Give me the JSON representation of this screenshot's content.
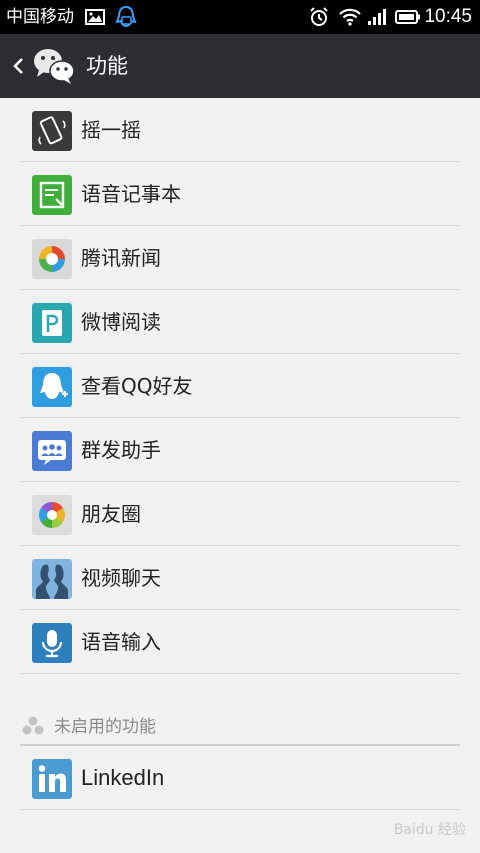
{
  "status_bar": {
    "carrier": "中国移动",
    "time": "10:45",
    "icons": [
      "image-icon",
      "qq-notification-icon",
      "alarm-icon",
      "wifi-icon",
      "signal-icon",
      "battery-icon"
    ]
  },
  "action_bar": {
    "title": "功能",
    "back_icon": "chevron-left-icon",
    "logo_icon": "wechat-logo-icon"
  },
  "enabled_features": [
    {
      "label": "摇一摇",
      "icon": "shake-icon",
      "color": "#3a3a3a"
    },
    {
      "label": "语音记事本",
      "icon": "voice-notepad-icon",
      "color": "#3fae3a"
    },
    {
      "label": "腾讯新闻",
      "icon": "tencent-news-icon",
      "color": "#d9d9d9"
    },
    {
      "label": "微博阅读",
      "icon": "weibo-reading-icon",
      "color": "#2aa7b0"
    },
    {
      "label": "查看QQ好友",
      "icon": "qq-friends-icon",
      "color": "#2f9ee0"
    },
    {
      "label": "群发助手",
      "icon": "broadcast-assistant-icon",
      "color": "#4a7cd6"
    },
    {
      "label": "朋友圈",
      "icon": "moments-icon",
      "color": "#dcdcdc"
    },
    {
      "label": "视频聊天",
      "icon": "video-chat-icon",
      "color": "#7fb4de"
    },
    {
      "label": "语音输入",
      "icon": "voice-input-icon",
      "color": "#2e7fbd"
    }
  ],
  "disabled_section": {
    "label": "未启用的功能",
    "icon": "disabled-features-icon",
    "items": [
      {
        "label": "LinkedIn",
        "icon": "linkedin-icon",
        "color": "#4a9bd1"
      }
    ]
  },
  "watermark": "Baidu 经验"
}
